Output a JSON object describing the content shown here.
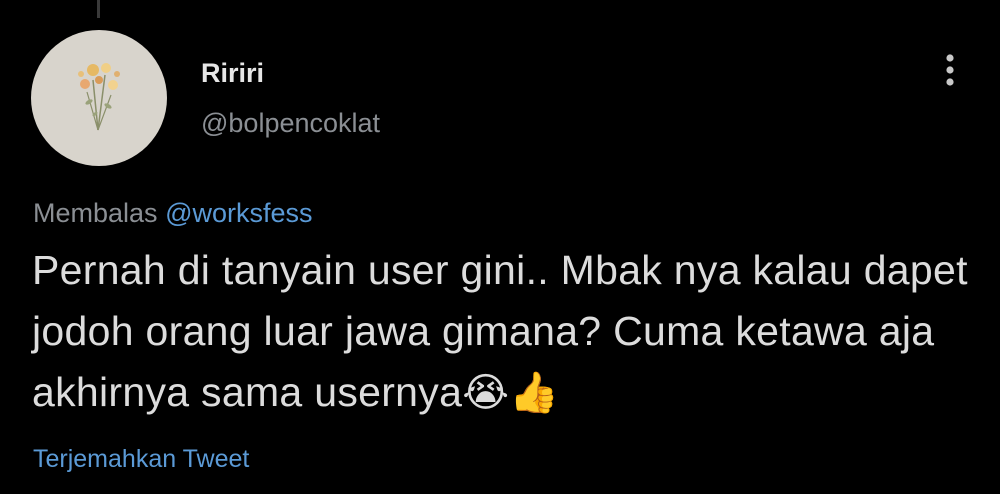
{
  "tweet": {
    "author": {
      "display_name": "Ririri",
      "handle": "@bolpencoklat",
      "avatar_icon": "flower-bouquet-icon"
    },
    "reply": {
      "prefix": "Membalas",
      "mention": "@worksfess"
    },
    "text": "Pernah di tanyain user gini.. Mbak nya kalau dapet jodoh orang luar jawa gimana? Cuma ketawa aja akhirnya sama usernya",
    "emojis": [
      "😭",
      "👍"
    ],
    "translate_label": "Terjemahkan Tweet"
  },
  "colors": {
    "background": "#000000",
    "text_primary": "#dcdcdc",
    "text_secondary": "#8b8f94",
    "link": "#5b9ad6",
    "avatar_bg": "#d8d4cc"
  }
}
